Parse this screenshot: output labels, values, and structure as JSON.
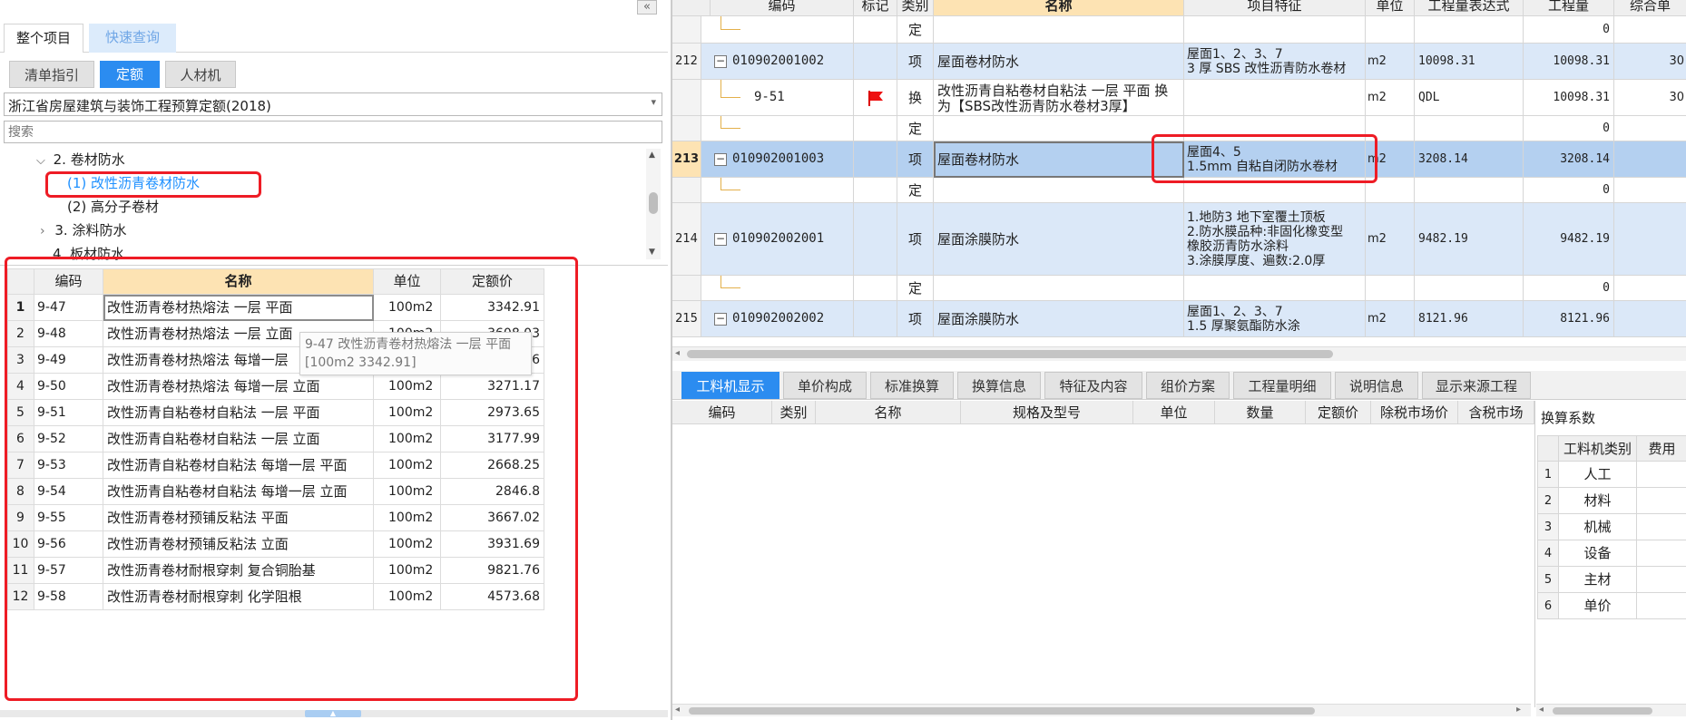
{
  "left": {
    "collapse_icon": "«",
    "top_tabs": [
      "整个项目",
      "快速查询"
    ],
    "sub_tabs": [
      "清单指引",
      "定额",
      "人材机"
    ],
    "quota_library": "浙江省房屋建筑与装饰工程预算定额(2018)",
    "search_placeholder": "搜索",
    "tree": [
      {
        "label": "2. 卷材防水",
        "arrow": "⌄"
      },
      {
        "label": "(1) 改性沥青卷材防水"
      },
      {
        "label": "(2) 高分子卷材"
      },
      {
        "label": "3. 涂料防水",
        "arrow": "›"
      },
      {
        "label": "4. 板材防水"
      }
    ],
    "table": {
      "headers": [
        "编码",
        "名称",
        "单位",
        "定额价"
      ],
      "rows": [
        {
          "no": "1",
          "code": "9-47",
          "name": "改性沥青卷材热熔法 一层 平面",
          "unit": "100m2",
          "price": "3342.91"
        },
        {
          "no": "2",
          "code": "9-48",
          "name": "改性沥青卷材热熔法 一层 立面",
          "unit": "100m2",
          "price": "3608.03"
        },
        {
          "no": "3",
          "code": "9-49",
          "name": "改性沥青卷材热熔法 每增一层",
          "unit": "100m2",
          "price": "2866.56"
        },
        {
          "no": "4",
          "code": "9-50",
          "name": "改性沥青卷材热熔法 每增一层 立面",
          "unit": "100m2",
          "price": "3271.17"
        },
        {
          "no": "5",
          "code": "9-51",
          "name": "改性沥青自粘卷材自粘法 一层 平面",
          "unit": "100m2",
          "price": "2973.65"
        },
        {
          "no": "6",
          "code": "9-52",
          "name": "改性沥青自粘卷材自粘法 一层 立面",
          "unit": "100m2",
          "price": "3177.99"
        },
        {
          "no": "7",
          "code": "9-53",
          "name": "改性沥青自粘卷材自粘法 每增一层 平面",
          "unit": "100m2",
          "price": "2668.25"
        },
        {
          "no": "8",
          "code": "9-54",
          "name": "改性沥青自粘卷材自粘法 每增一层 立面",
          "unit": "100m2",
          "price": "2846.8"
        },
        {
          "no": "9",
          "code": "9-55",
          "name": "改性沥青卷材预铺反粘法 平面",
          "unit": "100m2",
          "price": "3667.02"
        },
        {
          "no": "10",
          "code": "9-56",
          "name": "改性沥青卷材预铺反粘法 立面",
          "unit": "100m2",
          "price": "3931.69"
        },
        {
          "no": "11",
          "code": "9-57",
          "name": "改性沥青卷材耐根穿刺 复合铜胎基",
          "unit": "100m2",
          "price": "9821.76"
        },
        {
          "no": "12",
          "code": "9-58",
          "name": "改性沥青卷材耐根穿刺 化学阻根",
          "unit": "100m2",
          "price": "4573.68"
        }
      ]
    },
    "tooltip": {
      "line1": "9-47 改性沥青卷材热熔法 一层 平面",
      "line2": "[100m2 3342.91]"
    }
  },
  "right": {
    "headers": [
      "编码",
      "标记",
      "类别",
      "名称",
      "项目特征",
      "单位",
      "工程量表达式",
      "工程量",
      "综合单"
    ],
    "rows": [
      {
        "no": "",
        "code": "",
        "mark": "",
        "type": "定",
        "name": "",
        "feat": "",
        "unit": "",
        "expr": "",
        "qty": "0",
        "price": ""
      },
      {
        "no": "212",
        "code": "010902001002",
        "mark": "",
        "type": "项",
        "name": "屋面卷材防水",
        "feat": "屋面1、2、3、7\n3 厚 SBS 改性沥青防水卷材",
        "unit": "m2",
        "expr": "10098.31",
        "qty": "10098.31",
        "price": "30"
      },
      {
        "no": "",
        "code": "9-51",
        "mark": "flag",
        "type": "换",
        "name": "改性沥青自粘卷材自粘法 一层 平面 换为【SBS改性沥青防水卷材3厚】",
        "feat": "",
        "unit": "m2",
        "expr": "QDL",
        "qty": "10098.31",
        "price": "30"
      },
      {
        "no": "",
        "code": "",
        "mark": "",
        "type": "定",
        "name": "",
        "feat": "",
        "unit": "",
        "expr": "",
        "qty": "0",
        "price": ""
      },
      {
        "no": "213",
        "code": "010902001003",
        "mark": "",
        "type": "项",
        "name": "屋面卷材防水",
        "feat": "屋面4、5\n1.5mm 自粘自闭防水卷材",
        "unit": "m2",
        "expr": "3208.14",
        "qty": "3208.14",
        "price": ""
      },
      {
        "no": "",
        "code": "",
        "mark": "",
        "type": "定",
        "name": "",
        "feat": "",
        "unit": "",
        "expr": "",
        "qty": "0",
        "price": ""
      },
      {
        "no": "214",
        "code": "010902002001",
        "mark": "",
        "type": "项",
        "name": "屋面涂膜防水",
        "feat": "1.地防3 地下室覆土顶板\n2.防水膜品种:非固化橡变型\n橡胶沥青防水涂料\n3.涂膜厚度、遍数:2.0厚",
        "unit": "m2",
        "expr": "9482.19",
        "qty": "9482.19",
        "price": ""
      },
      {
        "no": "",
        "code": "",
        "mark": "",
        "type": "定",
        "name": "",
        "feat": "",
        "unit": "",
        "expr": "",
        "qty": "0",
        "price": ""
      },
      {
        "no": "215",
        "code": "010902002002",
        "mark": "",
        "type": "项",
        "name": "屋面涂膜防水",
        "feat": "屋面1、2、3、7\n1.5 厚聚氨酯防水涂",
        "unit": "m2",
        "expr": "8121.96",
        "qty": "8121.96",
        "price": ""
      }
    ],
    "bottom_tabs": [
      "工料机显示",
      "单价构成",
      "标准换算",
      "换算信息",
      "特征及内容",
      "组价方案",
      "工程量明细",
      "说明信息",
      "显示来源工程"
    ],
    "detail_headers": [
      "编码",
      "类别",
      "名称",
      "规格及型号",
      "单位",
      "数量",
      "定额价",
      "除税市场价",
      "含税市场"
    ],
    "coef": {
      "title": "换算系数",
      "headers": [
        "工料机类别",
        "费用"
      ],
      "rows": [
        {
          "no": "1",
          "cat": "人工"
        },
        {
          "no": "2",
          "cat": "材料"
        },
        {
          "no": "3",
          "cat": "机械"
        },
        {
          "no": "4",
          "cat": "设备"
        },
        {
          "no": "5",
          "cat": "主材"
        },
        {
          "no": "6",
          "cat": "单价"
        }
      ]
    }
  },
  "colors": {
    "accent": "#1e90ff",
    "red_box": "#ee1c25",
    "header_hl": "#fde3b3",
    "row_blue": "#dbe8f8",
    "row_sel": "#b4d0f0"
  }
}
